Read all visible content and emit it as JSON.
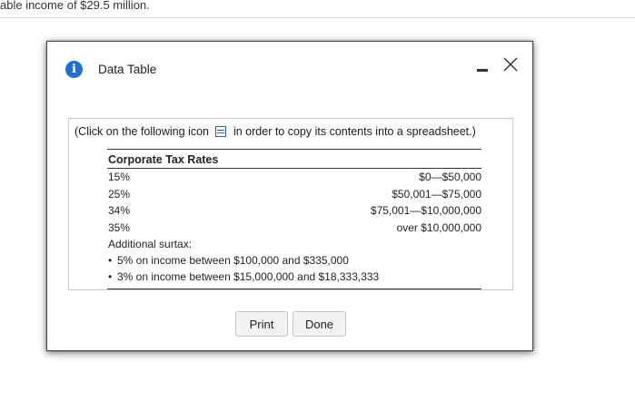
{
  "background": {
    "text": "able income of $29.5 million."
  },
  "dialog": {
    "title": "Data Table",
    "icons": {
      "info": "info-icon",
      "minimize": "minimize-icon",
      "close": "close-icon",
      "copy": "spreadsheet-copy-icon"
    },
    "instruction_before": "(Click on the following icon",
    "instruction_after": "in order to copy its contents into a spreadsheet.)",
    "table": {
      "heading": "Corporate Tax Rates",
      "rows": [
        {
          "rate": "15%",
          "range": "$0—$50,000"
        },
        {
          "rate": "25%",
          "range": "$50,001—$75,000"
        },
        {
          "rate": "34%",
          "range": "$75,001—$10,000,000"
        },
        {
          "rate": "35%",
          "range": "over $10,000,000"
        }
      ],
      "surtax_label": "Additional surtax:",
      "surtax_items": [
        "5% on income between $100,000 and $335,000",
        "3% on income between $15,000,000 and $18,333,333"
      ]
    },
    "buttons": {
      "print": "Print",
      "done": "Done"
    },
    "colors": {
      "info_icon": "#1e6fd0",
      "border": "#4a4a4a"
    }
  }
}
